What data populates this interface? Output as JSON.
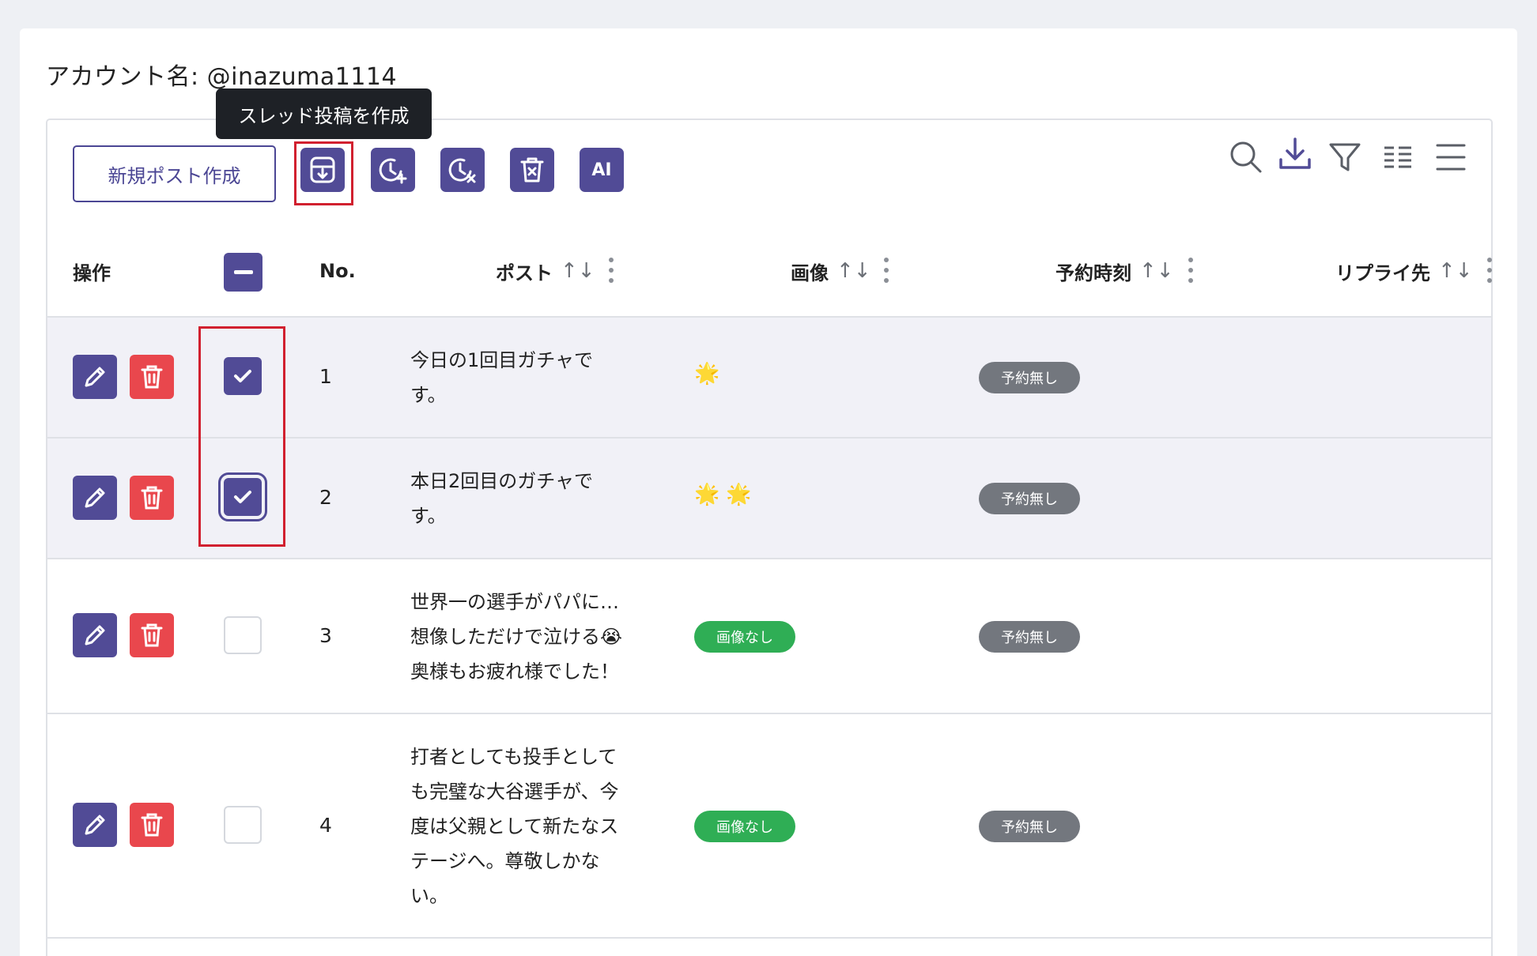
{
  "account_label": "アカウント名: @inazuma1114",
  "tooltip": "スレッド投稿を作成",
  "toolbar": {
    "new_post_label": "新規ポスト作成",
    "buttons": [
      "thread-create",
      "schedule-add",
      "schedule-remove",
      "bulk-delete",
      "ai"
    ],
    "ai_label": "AI",
    "right_icons": [
      "search-icon",
      "download-icon",
      "filter-icon",
      "columns-icon",
      "menu-icon"
    ]
  },
  "columns": {
    "actions": "操作",
    "no": "No.",
    "post": "ポスト",
    "image": "画像",
    "schedule": "予約時刻",
    "reply": "リプライ先",
    "sort_glyph": "↑↓"
  },
  "rows": [
    {
      "no": "1",
      "post": "今日の1回目ガチャで\nす。",
      "stars": "🌟",
      "image_badge": "",
      "schedule": "予約無し",
      "checked": true
    },
    {
      "no": "2",
      "post": "本日2回目のガチャで\nす。",
      "stars": "🌟🌟",
      "image_badge": "",
      "schedule": "予約無し",
      "checked": true
    },
    {
      "no": "3",
      "post": "世界一の選手がパパに…\n想像しただけで泣ける😭\n奥様もお疲れ様でした！",
      "stars": "",
      "image_badge": "画像なし",
      "schedule": "予約無し",
      "checked": false
    },
    {
      "no": "4",
      "post": "打者としても投手として\nも完璧な大谷選手が、今\n度は父親として新たなス\nテージへ。尊敬しかな\nい。",
      "stars": "",
      "image_badge": "画像なし",
      "schedule": "予約無し",
      "checked": false
    }
  ],
  "colors": {
    "primary": "#514b96",
    "danger": "#e9474d",
    "success": "#2fae55",
    "muted": "#73777e",
    "highlight": "#d1202f"
  }
}
